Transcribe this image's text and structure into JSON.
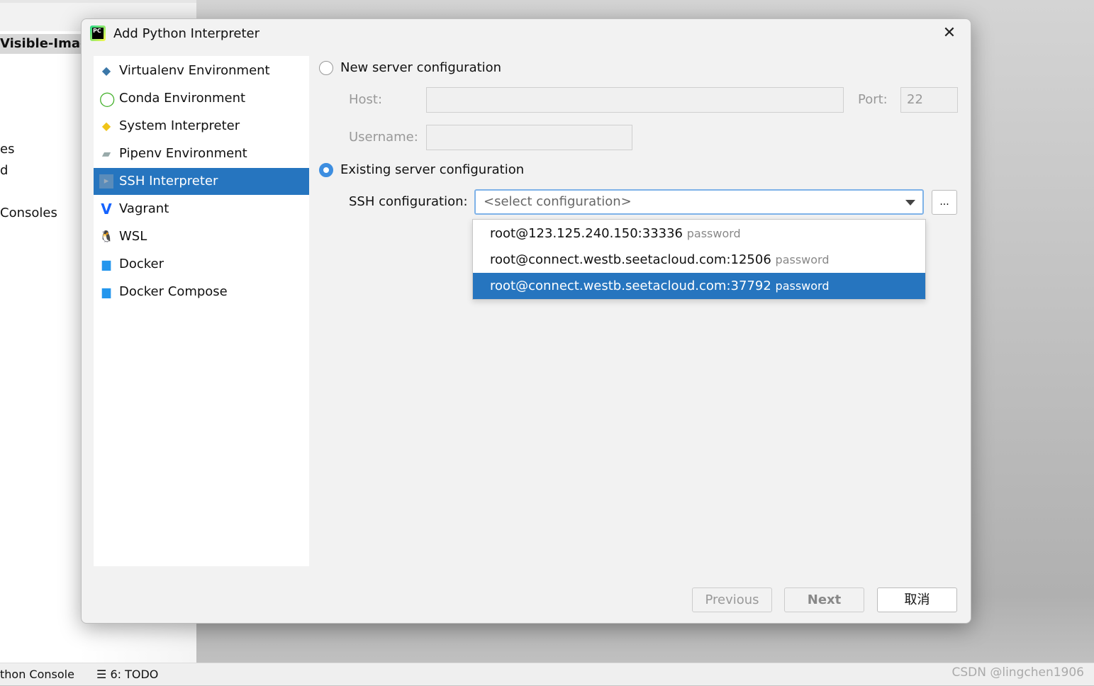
{
  "background": {
    "project_title": "Visible-Image",
    "side_items": [
      "es",
      "d",
      "Consoles"
    ],
    "status_items": [
      "thon Console",
      "6: TODO"
    ],
    "watermark": "CSDN @lingchen1906"
  },
  "dialog": {
    "title": "Add Python Interpreter",
    "types": [
      {
        "label": "Virtualenv Environment",
        "icon": "virtualenv-icon"
      },
      {
        "label": "Conda Environment",
        "icon": "conda-icon"
      },
      {
        "label": "System Interpreter",
        "icon": "python-icon"
      },
      {
        "label": "Pipenv Environment",
        "icon": "pipenv-icon"
      },
      {
        "label": "SSH Interpreter",
        "icon": "ssh-icon",
        "selected": true
      },
      {
        "label": "Vagrant",
        "icon": "vagrant-icon"
      },
      {
        "label": "WSL",
        "icon": "linux-icon"
      },
      {
        "label": "Docker",
        "icon": "docker-icon"
      },
      {
        "label": "Docker Compose",
        "icon": "docker-compose-icon"
      }
    ],
    "new_server": {
      "label": "New server configuration",
      "selected": false,
      "host_label": "Host:",
      "host_value": "",
      "port_label": "Port:",
      "port_value": "22",
      "username_label": "Username:",
      "username_value": ""
    },
    "existing_server": {
      "label": "Existing server configuration",
      "selected": true,
      "ssh_label": "SSH configuration:",
      "placeholder": "<select configuration>",
      "browse_label": "...",
      "options": [
        {
          "host": "root@123.125.240.150:33336",
          "auth": "password"
        },
        {
          "host": "root@connect.westb.seetacloud.com:12506",
          "auth": "password"
        },
        {
          "host": "root@connect.westb.seetacloud.com:37792",
          "auth": "password",
          "highlighted": true
        }
      ]
    },
    "buttons": {
      "previous": "Previous",
      "next": "Next",
      "cancel": "取消"
    }
  },
  "colors": {
    "selection": "#2675bf",
    "focus": "#7eb2e8"
  }
}
